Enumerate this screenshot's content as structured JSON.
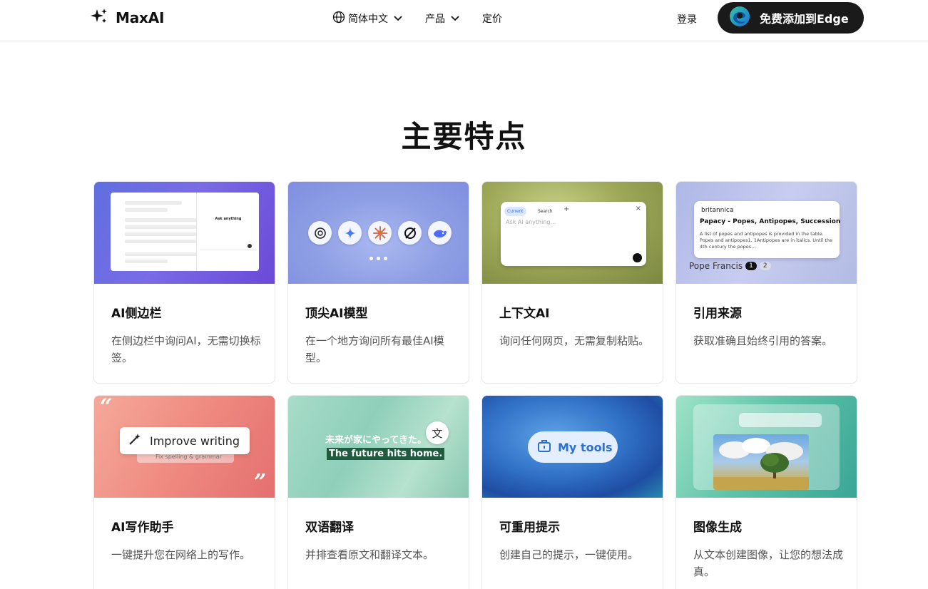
{
  "header": {
    "logo_text": "MaxAI",
    "nav": [
      {
        "label": "简体中文",
        "icon": "globe-icon",
        "has_dropdown": true
      },
      {
        "label": "产品",
        "has_dropdown": true
      },
      {
        "label": "定价",
        "has_dropdown": false
      }
    ],
    "login_label": "登录",
    "cta_label": "免费添加到Edge",
    "cta_icon": "edge-logo-icon"
  },
  "section": {
    "title": "主要特点"
  },
  "features": [
    {
      "title": "AI侧边栏",
      "desc": "在侧边栏中询问AI，无需切换标签。",
      "image": {
        "ask_text": "Ask anything"
      }
    },
    {
      "title": "顶尖AI模型",
      "desc": "在一个地方询问所有最佳AI模型。",
      "image": {
        "models": [
          "chatgpt-icon",
          "gemini-icon",
          "claude-icon",
          "grok-icon",
          "deepseek-icon"
        ]
      }
    },
    {
      "title": "上下文AI",
      "desc": "询问任何网页，无需复制粘贴。",
      "image": {
        "tab_current": "Current",
        "tab_search": "Search",
        "placeholder": "Ask AI anything..."
      }
    },
    {
      "title": "引用来源",
      "desc": "获取准确且始终引用的答案。",
      "image": {
        "source": "britannica",
        "headline": "Papacy - Popes, Antipopes, Succession",
        "body": "A list of popes and antipopes is provided in the table. Popes and antipopes1. 1Antipopes are in italics. Until the 4th century the popes...",
        "pope": "Pope Francis",
        "cite1": "1",
        "cite2": "2"
      }
    },
    {
      "title": "AI写作助手",
      "desc": "一键提升您在网络上的写作。",
      "image": {
        "improve": "Improve writing",
        "fix": "Fix spelling & grammar"
      }
    },
    {
      "title": "双语翻译",
      "desc": "并排查看原文和翻译文本。",
      "image": {
        "jp": "未来が家にやってきた。",
        "en": "The future hits home."
      }
    },
    {
      "title": "可重用提示",
      "desc": "创建自己的提示，一键使用。",
      "image": {
        "tools": "My tools"
      }
    },
    {
      "title": "图像生成",
      "desc": "从文本创建图像，让您的想法成真。",
      "image": {}
    }
  ],
  "colors": {
    "cta_bg": "#1a1a1a",
    "text_primary": "#111111",
    "text_secondary": "#555555",
    "border": "#e8e8e8"
  }
}
